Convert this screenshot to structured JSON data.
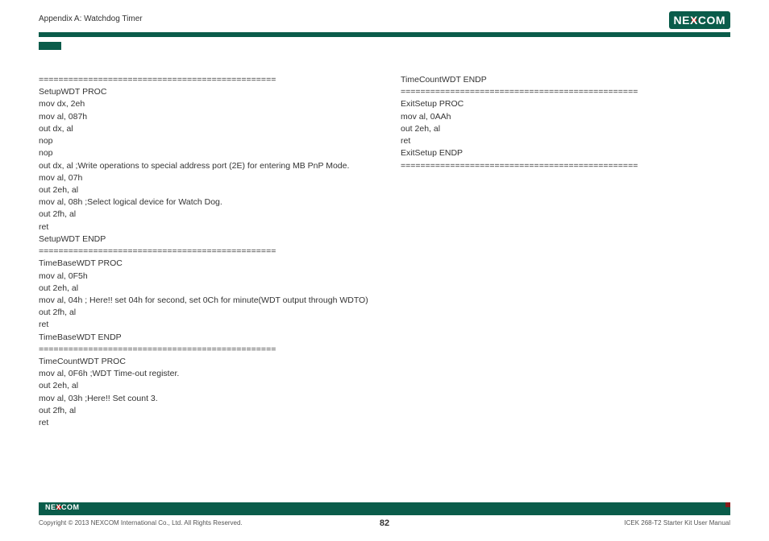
{
  "header": {
    "title": "Appendix A: Watchdog Timer"
  },
  "logo": {
    "text_ne": "NE",
    "text_x": "X",
    "text_com": "COM"
  },
  "col1": "================================================\nSetupWDT PROC\nmov dx, 2eh\nmov al, 087h\nout dx, al\nnop\nnop\nout dx, al ;Write operations to special address port (2E) for entering MB PnP Mode.\nmov al, 07h\nout 2eh, al\nmov al, 08h ;Select logical device for Watch Dog.\nout 2fh, al\nret\nSetupWDT ENDP\n================================================\nTimeBaseWDT PROC\nmov al, 0F5h\nout 2eh, al\nmov al, 04h ; Here!! set 04h for second, set 0Ch for minute(WDT output through WDTO)\nout 2fh, al\nret\nTimeBaseWDT ENDP\n================================================\nTimeCountWDT PROC\nmov al, 0F6h ;WDT Time-out register.\nout 2eh, al\nmov al, 03h ;Here!! Set count 3.\nout 2fh, al\nret",
  "col2": "TimeCountWDT ENDP\n================================================\nExitSetup PROC\nmov al, 0AAh\nout 2eh, al\nret\nExitSetup ENDP\n================================================",
  "footer": {
    "copyright": "Copyright © 2013 NEXCOM International Co., Ltd. All Rights Reserved.",
    "page": "82",
    "manual": "ICEK 268-T2 Starter Kit User Manual"
  }
}
